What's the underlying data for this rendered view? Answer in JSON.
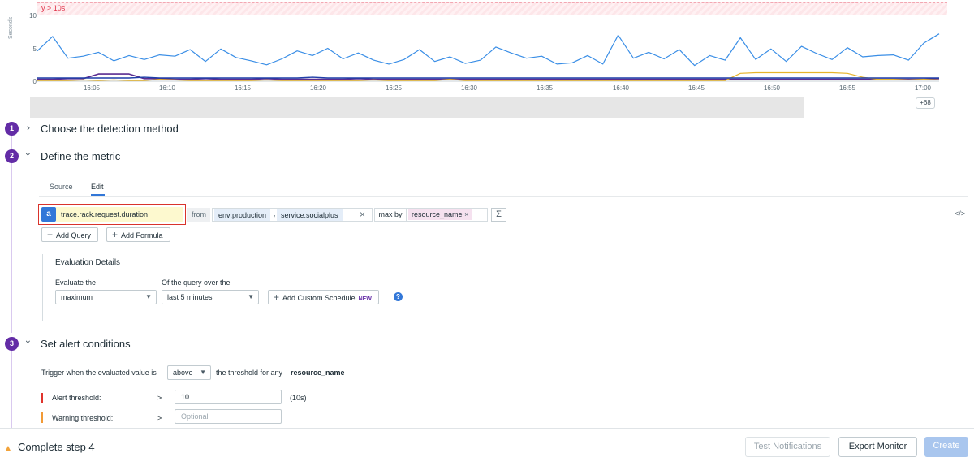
{
  "chart": {
    "threshold_label": "y > 10s",
    "y_axis_title": "Seconds",
    "y_ticks": [
      "10",
      "5",
      "0"
    ],
    "x_ticks": [
      "16:05",
      "16:10",
      "16:15",
      "16:20",
      "16:25",
      "16:30",
      "16:35",
      "16:40",
      "16:45",
      "16:50",
      "16:55",
      "17:00"
    ],
    "more_series_badge": "+68",
    "series_colors": {
      "blue": "#3a8ee6",
      "purple": "#5b2d91",
      "gold": "#e6b32a",
      "navy": "#1f3fa8",
      "orange": "#f08a3a"
    }
  },
  "chart_data": {
    "type": "line",
    "ylim": [
      0,
      10
    ],
    "ylabel": "Seconds",
    "x": [
      "16:02",
      "16:03",
      "16:04",
      "16:05",
      "16:06",
      "16:07",
      "16:08",
      "16:09",
      "16:10",
      "16:11",
      "16:12",
      "16:13",
      "16:14",
      "16:15",
      "16:16",
      "16:17",
      "16:18",
      "16:19",
      "16:20",
      "16:21",
      "16:22",
      "16:23",
      "16:24",
      "16:25",
      "16:26",
      "16:27",
      "16:28",
      "16:29",
      "16:30",
      "16:31",
      "16:32",
      "16:33",
      "16:34",
      "16:35",
      "16:36",
      "16:37",
      "16:38",
      "16:39",
      "16:40",
      "16:41",
      "16:42",
      "16:43",
      "16:44",
      "16:45",
      "16:46",
      "16:47",
      "16:48",
      "16:49",
      "16:50",
      "16:51",
      "16:52",
      "16:53",
      "16:54",
      "16:55",
      "16:56",
      "16:57",
      "16:58",
      "16:59",
      "17:00",
      "17:01"
    ],
    "series": [
      {
        "values": [
          4.6,
          6.8,
          3.5,
          3.8,
          4.4,
          3.1,
          3.9,
          3.3,
          4.0,
          3.8,
          4.8,
          3.0,
          4.9,
          3.6,
          3.1,
          2.5,
          3.4,
          4.6,
          3.9,
          5.0,
          3.4,
          4.3,
          3.2,
          2.6,
          3.3,
          4.8,
          3.0,
          3.7,
          2.7,
          3.2,
          5.2,
          4.3,
          3.5,
          3.8,
          2.6,
          2.8,
          3.9,
          2.6,
          7.0,
          3.5,
          4.4,
          3.4,
          4.8,
          2.4,
          3.9,
          3.2,
          6.6,
          3.3,
          4.9,
          3.0,
          5.3,
          4.2,
          3.3,
          5.1,
          3.7,
          3.9,
          4.0,
          3.2,
          5.8,
          7.2
        ]
      },
      {
        "values": [
          0.3,
          0.3,
          0.4,
          0.4,
          1.1,
          1.1,
          1.1,
          0.4,
          0.4,
          0.3,
          0.3,
          0.4,
          0.3,
          0.3,
          0.3,
          0.4,
          0.3,
          0.3,
          0.3,
          0.3,
          0.3,
          0.4,
          0.3,
          0.3,
          0.3,
          0.3,
          0.3,
          0.3,
          0.3,
          0.3,
          0.3,
          0.3,
          0.3,
          0.3,
          0.3,
          0.3,
          0.3,
          0.3,
          0.3,
          0.3,
          0.3,
          0.3,
          0.3,
          0.3,
          0.3,
          0.3,
          0.3,
          0.3,
          0.3,
          0.3,
          0.3,
          0.3,
          0.3,
          0.3,
          0.3,
          0.3,
          0.3,
          0.3,
          0.3,
          0.4
        ]
      },
      {
        "values": [
          0.1,
          0.1,
          0.1,
          0.2,
          0.1,
          0.2,
          0.1,
          0.1,
          0.3,
          0.2,
          0.1,
          0.1,
          0.1,
          0.1,
          0.1,
          0.2,
          0.1,
          0.1,
          0.1,
          0.1,
          0.1,
          0.1,
          0.2,
          0.1,
          0.1,
          0.1,
          0.1,
          0.3,
          0.1,
          0.1,
          0.1,
          0.1,
          0.1,
          0.1,
          0.1,
          0.1,
          0.1,
          0.1,
          0.1,
          0.1,
          0.1,
          0.1,
          0.1,
          0.1,
          0.1,
          0.1,
          1.2,
          1.3,
          1.3,
          1.3,
          1.3,
          1.3,
          1.3,
          1.2,
          0.6,
          0.3,
          0.3,
          0.2,
          0.3,
          0.2
        ]
      },
      {
        "values": [
          0.5,
          0.5,
          0.5,
          0.5,
          0.5,
          0.5,
          0.5,
          0.6,
          0.5,
          0.5,
          0.5,
          0.5,
          0.5,
          0.5,
          0.5,
          0.5,
          0.5,
          0.5,
          0.6,
          0.5,
          0.5,
          0.5,
          0.5,
          0.5,
          0.5,
          0.5,
          0.5,
          0.5,
          0.5,
          0.5,
          0.5,
          0.5,
          0.5,
          0.5,
          0.5,
          0.5,
          0.5,
          0.5,
          0.5,
          0.5,
          0.5,
          0.5,
          0.5,
          0.5,
          0.5,
          0.5,
          0.5,
          0.5,
          0.5,
          0.5,
          0.5,
          0.5,
          0.5,
          0.5,
          0.5,
          0.5,
          0.5,
          0.5,
          0.5,
          0.5
        ]
      }
    ]
  },
  "steps": [
    {
      "num": "1",
      "title": "Choose the detection method",
      "expanded": false
    },
    {
      "num": "2",
      "title": "Define the metric",
      "expanded": true
    },
    {
      "num": "3",
      "title": "Set alert conditions",
      "expanded": true
    }
  ],
  "metric_tabs": [
    "Source",
    "Edit"
  ],
  "query": {
    "letter": "a",
    "metric": "trace.rack.request.duration",
    "from_label": "from",
    "tags": [
      "env:production",
      "service:socialplus"
    ],
    "tag_separator": ",",
    "clear_glyph": "×",
    "aggregator": "max by",
    "group_by": "resource_name",
    "remove_glyph": "×",
    "sigma": "Σ",
    "code_glyph": "</>"
  },
  "buttons": {
    "add_query": "Add Query",
    "add_formula": "Add Formula",
    "add_schedule": "Add Custom Schedule",
    "new_badge": "NEW"
  },
  "evaluation": {
    "title": "Evaluation Details",
    "evaluate_label": "Evaluate the",
    "evaluate_value": "maximum",
    "window_label": "Of the query over the",
    "window_value": "last 5 minutes",
    "help_glyph": "?"
  },
  "alert": {
    "trigger_prefix": "Trigger when the evaluated value is",
    "comparator": "above",
    "trigger_suffix": "the threshold for any",
    "group": "resource_name",
    "alert_label": "Alert threshold:",
    "alert_op": ">",
    "alert_value": "10",
    "alert_hint": "(10s)",
    "warning_label": "Warning threshold:",
    "warning_op": ">",
    "warning_placeholder": "Optional",
    "alert_color": "#e0332c",
    "warning_color": "#f29a36"
  },
  "footer": {
    "message": "Complete step 4",
    "test_notifications": "Test Notifications",
    "export_monitor": "Export Monitor",
    "create": "Create",
    "create_color": "#a9c6ee"
  }
}
